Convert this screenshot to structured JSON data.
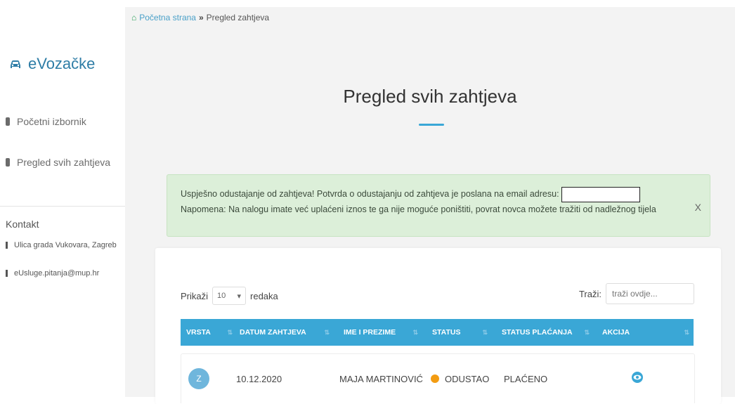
{
  "colors": {
    "accent": "#3aa7d6",
    "brand": "#2e7da6",
    "alert_bg": "#dcefd9",
    "status_withdrawn": "#f39c12",
    "breadcrumb_home": "#2ca05a"
  },
  "sidebar": {
    "brand": "eVozačke",
    "items": [
      {
        "label": "Početni izbornik",
        "icon": "book-icon"
      },
      {
        "label": "Pregled svih zahtjeva",
        "icon": "list-icon"
      }
    ],
    "contact_title": "Kontakt",
    "contact": [
      {
        "text": "Ulica grada Vukovara, Zagreb",
        "icon": "map-marker-icon"
      },
      {
        "text": "eUsluge.pitanja@mup.hr",
        "icon": "mail-icon"
      }
    ]
  },
  "breadcrumb": {
    "home": "Početna strana",
    "separator": "»",
    "current": "Pregled zahtjeva"
  },
  "page_title": "Pregled svih zahtjeva",
  "alert": {
    "line1": "Uspješno odustajanje od zahtjeva! Potvrda o odustajanju od zahtjeva je poslana na email adresu:",
    "line2": "Napomena: Na nalogu imate već uplaćeni iznos te ga nije moguće poništiti, povrat novca možete tražiti od nadležnog tijela",
    "close": "X"
  },
  "table_controls": {
    "show_label": "Prikaži",
    "page_size": "10",
    "rows_label": "redaka",
    "search_label": "Traži:",
    "search_placeholder": "traži ovdje..."
  },
  "table": {
    "headers": [
      "VRSTA",
      "DATUM ZAHTJEVA",
      "IME I PREZIME",
      "STATUS",
      "STATUS PLAĆANJA",
      "AKCIJA"
    ],
    "rows": [
      {
        "type": "Z",
        "date": "10.12.2020",
        "name": "MAJA MARTINOVIĆ",
        "status": "ODUSTAO",
        "payment": "PLAĆENO",
        "action_icon": "eye-icon"
      }
    ]
  }
}
